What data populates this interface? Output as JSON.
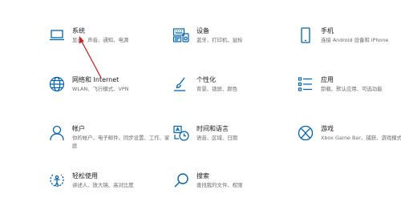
{
  "tiles": [
    {
      "id": "system",
      "title": "系统",
      "desc": "显示、声音、通知、电源",
      "icon": "laptop-icon"
    },
    {
      "id": "devices",
      "title": "设备",
      "desc": "蓝牙、打印机、鼠标",
      "icon": "keyboard-icon"
    },
    {
      "id": "phone",
      "title": "手机",
      "desc": "连接 Android 设备和 iPhone",
      "icon": "phone-icon"
    },
    {
      "id": "network",
      "title": "网络和 Internet",
      "desc": "WLAN、飞行模式、VPN",
      "icon": "globe-icon"
    },
    {
      "id": "personalization",
      "title": "个性化",
      "desc": "背景、锁屏、颜色",
      "icon": "paintbrush-icon"
    },
    {
      "id": "apps",
      "title": "应用",
      "desc": "卸载、默认应用、可选功能",
      "icon": "apps-list-icon"
    },
    {
      "id": "accounts",
      "title": "帐户",
      "desc": "你的帐户、电子邮件、同步设置、工作、家庭",
      "icon": "person-icon"
    },
    {
      "id": "time-language",
      "title": "时间和语言",
      "desc": "语音、区域、日期",
      "icon": "time-language-icon"
    },
    {
      "id": "gaming",
      "title": "游戏",
      "desc": "Xbox Game Bar、捕获、游戏模式",
      "icon": "xbox-icon"
    },
    {
      "id": "ease-of-access",
      "title": "轻松使用",
      "desc": "讲述人、放大镜、高对比度",
      "icon": "ease-of-access-icon"
    },
    {
      "id": "search",
      "title": "搜索",
      "desc": "查找我的文件、权限",
      "icon": "search-icon"
    }
  ],
  "colors": {
    "icon": "#0063b1",
    "arrow": "#cc2222"
  }
}
